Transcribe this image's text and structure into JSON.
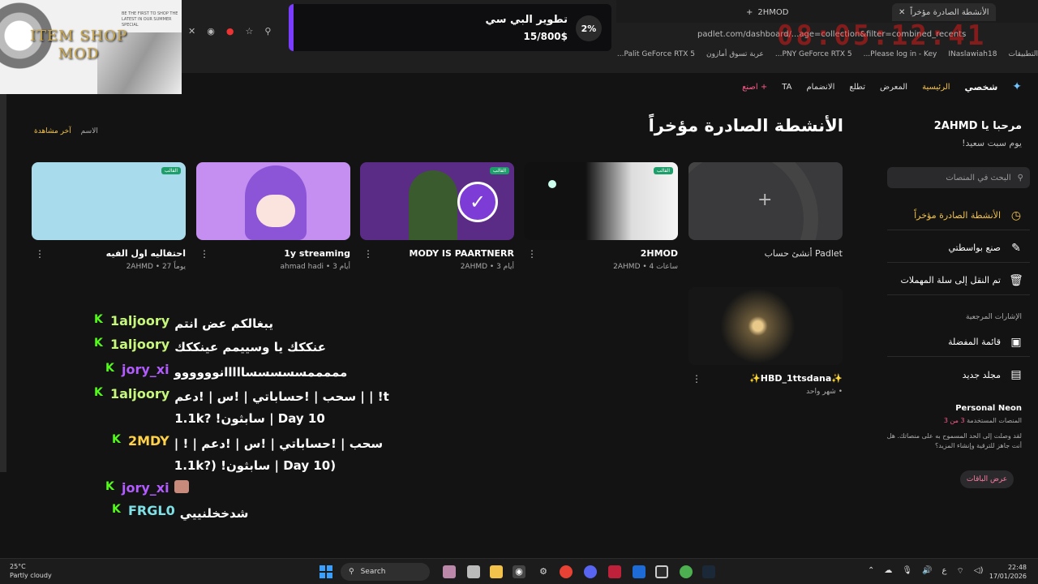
{
  "browser": {
    "tabs": [
      {
        "label": "2HMOD"
      },
      {
        "label": "الأنشطة الصادرة مؤخراً"
      }
    ],
    "url": "padlet.com/dashboard/...age=collection&filter=combined_recents",
    "clock_overlay": "08:05:12:41",
    "bookmarks": [
      "التطبيقات",
      "INaslawiah18",
      "Please log in - Key...",
      "PNY GeForce RTX 5...",
      "عربة تسوق أمازون",
      "Palit GeForce RTX 5..."
    ]
  },
  "overlay": {
    "shop_title_line1": "ITEM SHOP",
    "shop_title_line2": "MOD",
    "shop_small": "BE THE FIRST TO SHOP THE LATEST IN OUR SUMMER SPECIAL"
  },
  "goal": {
    "percent": "2%",
    "title": "تطوير البي سي",
    "amount": "15/800$"
  },
  "nav": {
    "mine": "شخصي",
    "home": "الرئيسية",
    "gallery": "المعرض",
    "learn": "تطلع",
    "join": "الانضمام",
    "ta": "TA",
    "create": "+ اصنع"
  },
  "sidebar": {
    "hello": "مرحبا يا 2AHMD",
    "greeting": "يوم سبت سعيد!",
    "search_placeholder": "البحث في المنصات",
    "items": [
      {
        "label": "الأنشطة الصادرة مؤخراً"
      },
      {
        "label": "صنع بواسطتي"
      },
      {
        "label": "تم النقل إلى سلة المهملات"
      }
    ],
    "bookmarks_label": "الإشارات المرجعية",
    "favorites": "قائمة المفضلة",
    "new_folder": "مجلد جديد",
    "plan_title": "Personal Neon",
    "plan_used_prefix": "المنصات المستخدمة",
    "plan_used": "3 من 3",
    "plan_desc": "لقد وصلت إلى الحد المسموح به على منصاتك. هل أنت جاهز للترقية وإنشاء المزيد؟",
    "plans_button": "عرض الباقات"
  },
  "main": {
    "title": "الأنشطة الصادرة مؤخراً",
    "sort_recent": "آخر مشاهدة",
    "sort_name": "الاسم",
    "cards": [
      {
        "title": "أنشئ حساب Padlet",
        "meta": "",
        "badge": ""
      },
      {
        "title": "2HMOD",
        "meta": "2AHMD • 4 ساعات",
        "badge": "القالب"
      },
      {
        "title": "MODY IS PAARTNERR",
        "meta": "2AHMD • 3 أيام",
        "badge": "القالب"
      },
      {
        "title": "1y streaming",
        "meta": "ahmad hadi • 3 أيام",
        "badge": ""
      },
      {
        "title": "احتفاليه اول الفيه",
        "meta": "2AHMD • 27 يوماً",
        "badge": "القالب"
      }
    ],
    "card_row2": {
      "title": "✨HBD_1ttsdana✨",
      "meta": "شهر واحد •"
    }
  },
  "chat": [
    {
      "user": "1aljoory",
      "text": "يبغالكم عض انتم",
      "color": "#c6f77b"
    },
    {
      "user": "1aljoory",
      "text": "عنككك يا وسييمم عينككك",
      "color": "#c6f77b"
    },
    {
      "user": "jory_xi",
      "text": "مممممسسسسسااااانوووووو",
      "color": "#b25bff"
    },
    {
      "user": "1aljoory",
      "text": "سحب | !حساباتي | !س | !دعم | | !t 1.1k? !سابثون | Day 10",
      "color": "#c6f77b"
    },
    {
      "user": "2MDY",
      "text": "سحب | !حساباتي | !س | !دعم | ! | 1.1k?) !سابثون | Day 10)",
      "color": "#ffd24a"
    },
    {
      "user": "jory_xi",
      "text": "",
      "color": "#b25bff"
    },
    {
      "user": "FRGL0",
      "text": "شدخخلنييي",
      "color": "#7fe0e6"
    }
  ],
  "taskbar": {
    "temp": "25°C",
    "weather": "Partly cloudy",
    "search": "Search",
    "time": "22:48",
    "date": "17/01/2026"
  }
}
